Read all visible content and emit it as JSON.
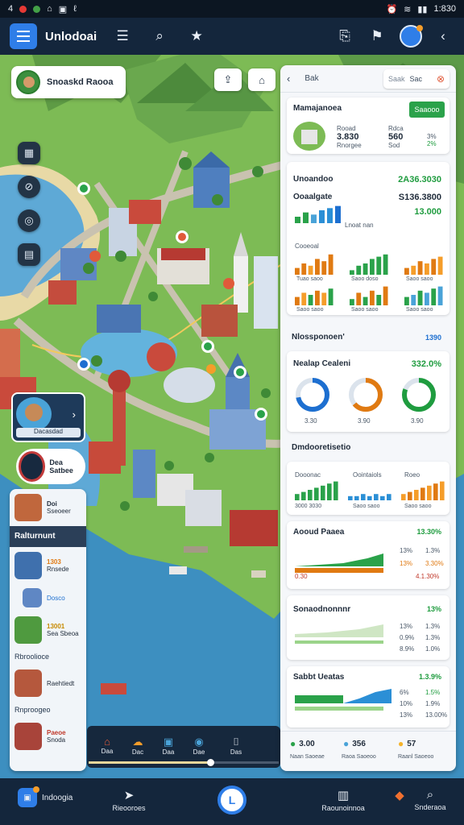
{
  "status": {
    "time": "1:830",
    "left_glyphs": [
      "4",
      "⌂",
      "▣",
      "ℓ"
    ]
  },
  "appbar": {
    "title": "Unlodoai"
  },
  "map": {
    "location_chip": "Snoaskd Raooa",
    "character_card_label": "Dacasdad",
    "character2_label": "Dea Satbee",
    "pins": [
      "pin-1",
      "pin-2",
      "pin-3",
      "pin-4",
      "pin-5",
      "pin-6",
      "pin-7",
      "pin-8"
    ]
  },
  "left_panel": {
    "item1": {
      "title": "Doi",
      "sub": "Sseoeer"
    },
    "header": "Ralturnunt",
    "item2": {
      "num": "1303",
      "sub": "Rnsede"
    },
    "item3": {
      "sub": "Dosco"
    },
    "item4": {
      "num": "13001",
      "sub": "Sea Sbeoa"
    },
    "sub1": "Rbroolioce",
    "item5": {
      "sub": "Raehtiedt"
    },
    "sub2": "Rnproogeo",
    "item6": {
      "title": "Paeoe",
      "sub": "Snoda"
    }
  },
  "mini_bar": {
    "items": [
      "Daa",
      "Dac",
      "Daa",
      "Dae",
      "Das"
    ],
    "progress": 0.64
  },
  "dashboard": {
    "back_label": "Bak",
    "search_placeholder": "Saak",
    "search_value": "Sac",
    "card1": {
      "title": "Mamajanoea",
      "button": "Saaooo",
      "stats": [
        {
          "label": "Rooad",
          "value": "3.830",
          "sub": "Rnorgee"
        },
        {
          "label": "Rdca",
          "value": "560",
          "sub": "Sod"
        },
        {
          "label": "",
          "value": "3%",
          "sub": "2%"
        }
      ]
    },
    "card2": {
      "title": "Unoandoo",
      "value": "2A36.3030",
      "sub_title": "Ooaalgate",
      "sub_value": "S136.3800",
      "sub_note": "Lnoat nan",
      "sub_value2": "13.000",
      "group_label": "Cooeoal",
      "bars_a": [
        3,
        5,
        4,
        7,
        6,
        9
      ],
      "bars_b": [
        2,
        4,
        5,
        7,
        8,
        9
      ],
      "bars_c": [
        3,
        4,
        6,
        5,
        7,
        8
      ],
      "bars_d": [
        4,
        6,
        5,
        7,
        6,
        8
      ],
      "bars_e": [
        3,
        6,
        4,
        7,
        5,
        9
      ],
      "bars_f": [
        4,
        5,
        7,
        6,
        8,
        9
      ],
      "caption_a": "Tuao saoo",
      "caption_b": "Saoo doso",
      "caption_c": "Saoo saoo",
      "caption_d": "Saoo saoo",
      "caption_e": "Saoo saoo",
      "caption_f": "Saoo saoo"
    },
    "section1": {
      "label": "Nlossponoen'",
      "value": "1390"
    },
    "card3": {
      "title": "Nealap Cealeni",
      "value": "332.0%",
      "donuts": [
        {
          "value": 0.72,
          "color": "#1d6fd0",
          "label": "3.30"
        },
        {
          "value": 0.64,
          "color": "#e07a12",
          "label": "3.90"
        },
        {
          "value": 0.81,
          "color": "#1f9c3f",
          "label": "3.90"
        }
      ]
    },
    "section2": {
      "label": "Dmdooretisetio"
    },
    "card4": {
      "labels": [
        "Dooonac",
        "Oointaiols",
        "Roeo"
      ],
      "captions": [
        "3000 3030",
        "Saoo saoo",
        "Saoo saoo"
      ],
      "bars": [
        [
          3,
          4,
          5,
          6,
          7,
          8,
          9
        ],
        [
          2,
          2,
          3,
          2,
          3,
          2,
          3
        ],
        [
          3,
          4,
          5,
          6,
          7,
          8,
          9
        ]
      ]
    },
    "card5": {
      "title": "Aooud Paaea",
      "value": "13.30%",
      "rows": [
        [
          "13%",
          "1.3%"
        ],
        [
          "13%",
          "3.30%"
        ],
        [
          "0.30",
          "4.1.30%"
        ]
      ]
    },
    "card6": {
      "title": "Sonaodnonnnr",
      "value": "13%",
      "rows": [
        [
          "13%",
          "1.3%"
        ],
        [
          "0.9%",
          "1.3%"
        ],
        [
          "8.9%",
          "1.0%"
        ]
      ]
    },
    "card7": {
      "title": "Sabbt Ueatas",
      "value": "1.3.9%",
      "rows": [
        [
          "6%",
          "1.5%"
        ],
        [
          "10%",
          "1.9%"
        ],
        [
          "13%",
          "13.00%"
        ]
      ]
    },
    "footer": [
      {
        "value": "3.00",
        "label": "Naan Saoeae"
      },
      {
        "value": "356",
        "label": "Raoa Saoeoo"
      },
      {
        "value": "57",
        "label": "Raanl Saoeoo"
      }
    ]
  },
  "bottom_nav": {
    "left_label": "Indoogia",
    "items": [
      "Rieooroes",
      "Raounoinnoa",
      "Snderaoa"
    ],
    "center": "L"
  }
}
